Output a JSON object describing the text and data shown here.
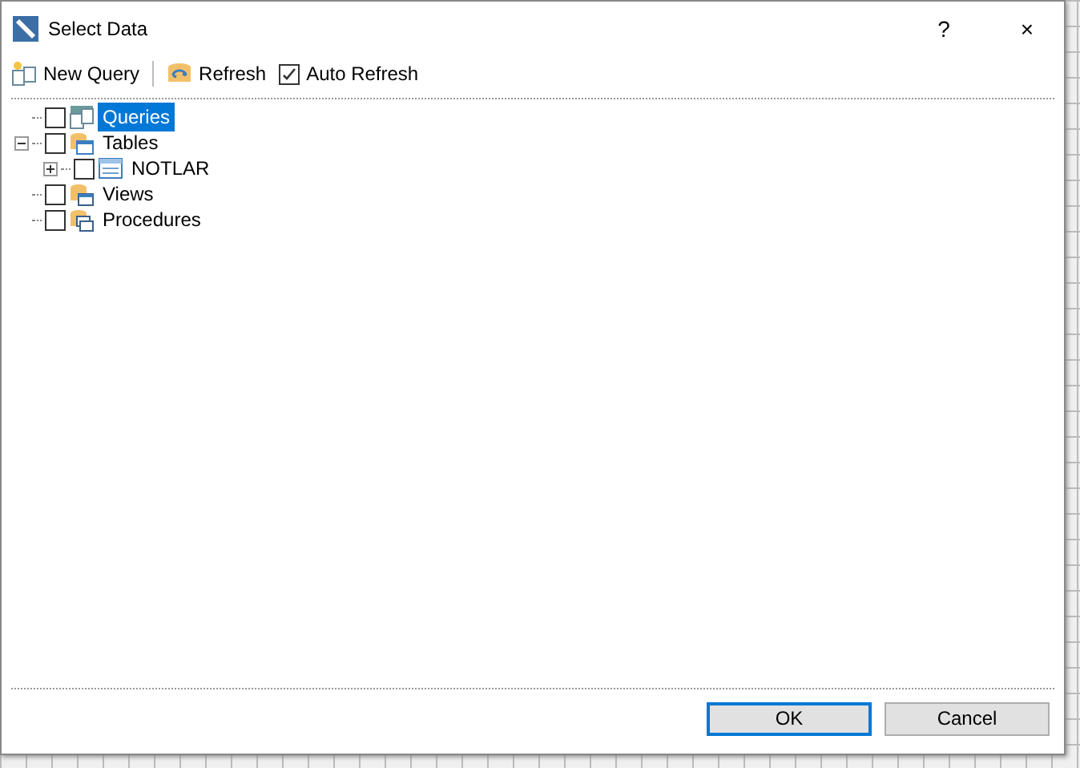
{
  "window": {
    "title": "Select Data",
    "help": "?",
    "close": "×"
  },
  "toolbar": {
    "new_query": "New Query",
    "refresh": "Refresh",
    "auto_refresh": {
      "label": "Auto Refresh",
      "checked": true
    }
  },
  "tree": [
    {
      "label": "Queries",
      "kind": "queries",
      "checked": false,
      "selected": true
    },
    {
      "label": "Tables",
      "kind": "tables",
      "checked": false,
      "selected": false,
      "expanded": true,
      "children": [
        {
          "label": "NOTLAR",
          "kind": "table",
          "checked": false,
          "selected": false,
          "expanded": false
        }
      ]
    },
    {
      "label": "Views",
      "kind": "views",
      "checked": false,
      "selected": false
    },
    {
      "label": "Procedures",
      "kind": "procedures",
      "checked": false,
      "selected": false
    }
  ],
  "buttons": [
    {
      "label": "OK",
      "kind": "default"
    },
    {
      "label": "Cancel",
      "kind": "normal"
    }
  ]
}
